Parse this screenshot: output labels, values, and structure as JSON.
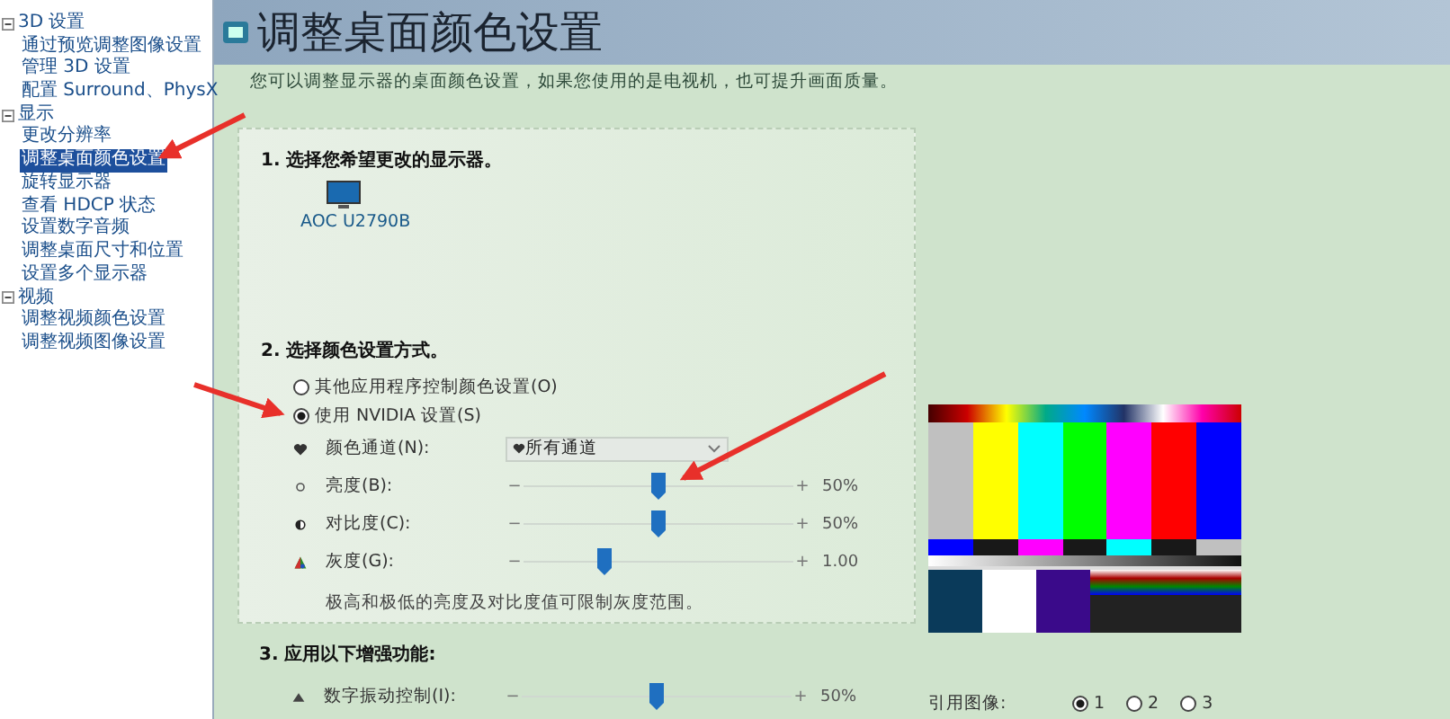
{
  "sidebar": {
    "groups": [
      {
        "label": "3D 设置",
        "expanded": true,
        "children": [
          {
            "label": "通过预览调整图像设置",
            "selected": false
          },
          {
            "label": "管理 3D 设置",
            "selected": false
          },
          {
            "label": "配置 Surround、PhysX",
            "selected": false
          }
        ]
      },
      {
        "label": "显示",
        "expanded": true,
        "children": [
          {
            "label": "更改分辨率",
            "selected": false
          },
          {
            "label": "调整桌面颜色设置",
            "selected": true
          },
          {
            "label": "旋转显示器",
            "selected": false
          },
          {
            "label": "查看 HDCP 状态",
            "selected": false
          },
          {
            "label": "设置数字音频",
            "selected": false
          },
          {
            "label": "调整桌面尺寸和位置",
            "selected": false
          },
          {
            "label": "设置多个显示器",
            "selected": false
          }
        ]
      },
      {
        "label": "视频",
        "expanded": true,
        "children": [
          {
            "label": "调整视频颜色设置",
            "selected": false
          },
          {
            "label": "调整视频图像设置",
            "selected": false
          }
        ]
      }
    ]
  },
  "page": {
    "title": "调整桌面颜色设置",
    "description": "您可以调整显示器的桌面颜色设置，如果您使用的是电视机，也可提升画面质量。"
  },
  "section_1": {
    "heading": "1.  选择您希望更改的显示器。",
    "display": "AOC U2790B"
  },
  "section_2": {
    "heading": "2.  选择颜色设置方式。",
    "options": [
      {
        "label": "其他应用程序控制颜色设置(O)",
        "selected": false
      },
      {
        "label": "使用 NVIDIA 设置(S)",
        "selected": true
      }
    ],
    "controls": [
      {
        "kind": "dropdown",
        "label": "颜色通道(N):",
        "value": "所有通道"
      },
      {
        "kind": "slider",
        "label": "亮度(B):",
        "min_sign": "−",
        "max_sign": "+",
        "level": 0.5,
        "reading": "50%"
      },
      {
        "kind": "slider",
        "label": "对比度(C):",
        "min_sign": "−",
        "max_sign": "+",
        "level": 0.5,
        "reading": "50%"
      },
      {
        "kind": "slider",
        "label": "灰度(G):",
        "min_sign": "−",
        "max_sign": "+",
        "level": 0.3,
        "reading": "1.00"
      }
    ],
    "note": "极高和极低的亮度及对比度值可限制灰度范围。"
  },
  "section_3": {
    "heading": "3.  应用以下增强功能:",
    "controls": [
      {
        "kind": "slider",
        "label": "数字振动控制(I):",
        "min_sign": "−",
        "max_sign": "+",
        "level": 0.5,
        "reading": "50%"
      }
    ]
  },
  "reference": {
    "label": "引用图像:",
    "options": [
      {
        "label": "1",
        "selected": true
      },
      {
        "label": "2",
        "selected": false
      },
      {
        "label": "3",
        "selected": false
      }
    ]
  }
}
